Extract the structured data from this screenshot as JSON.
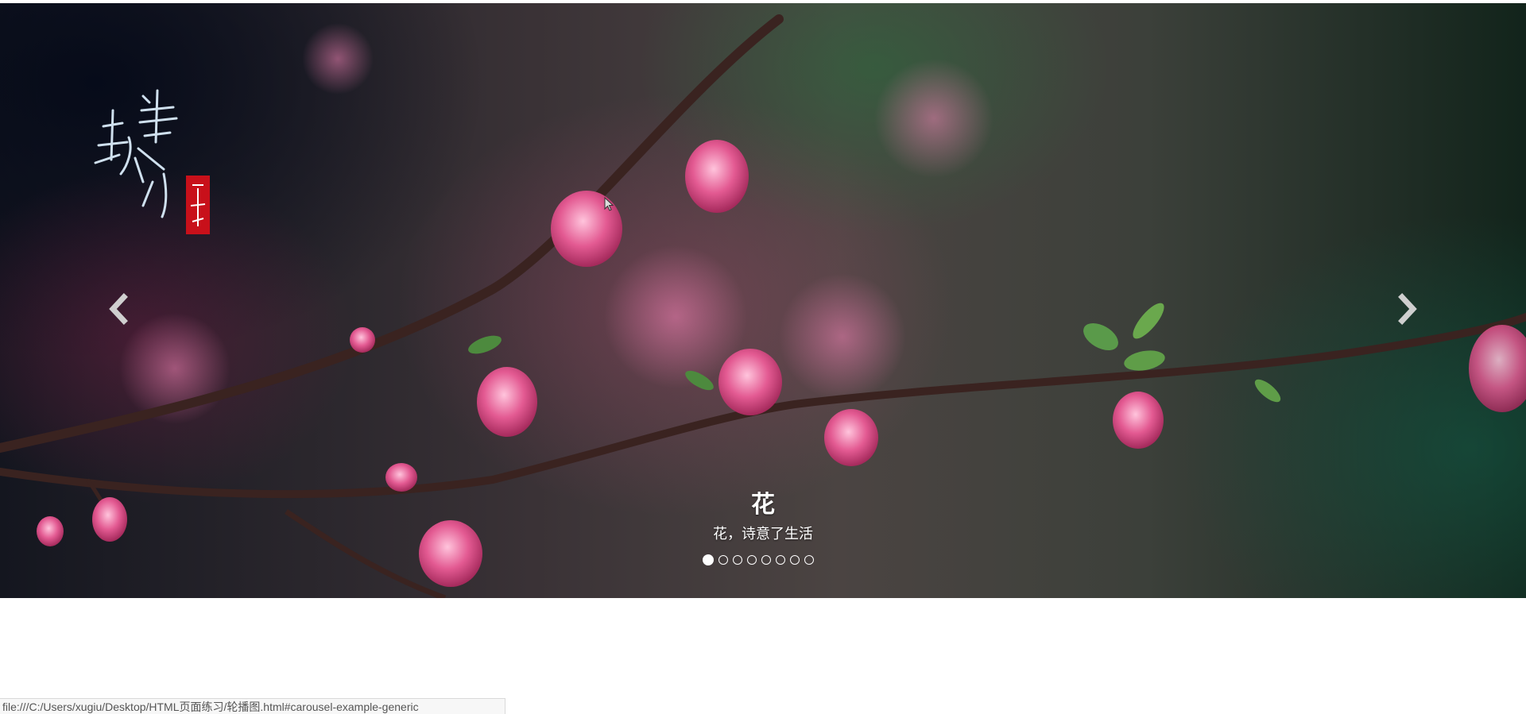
{
  "carousel": {
    "caption_title": "花",
    "caption_subtitle": "花，诗意了生活",
    "indicator_count": 8,
    "active_index": 0,
    "prev_label": "Previous",
    "next_label": "Next"
  },
  "logo": {
    "calligraphy_text": "半亩花田",
    "seal_color": "#c8101a"
  },
  "status_bar": {
    "url": "file:///C:/Users/xugiu/Desktop/HTML页面练习/轮播图.html#carousel-example-generic"
  },
  "colors": {
    "caption_text": "#ffffff",
    "blossom": "#e35a92",
    "branch": "#3a2320"
  }
}
